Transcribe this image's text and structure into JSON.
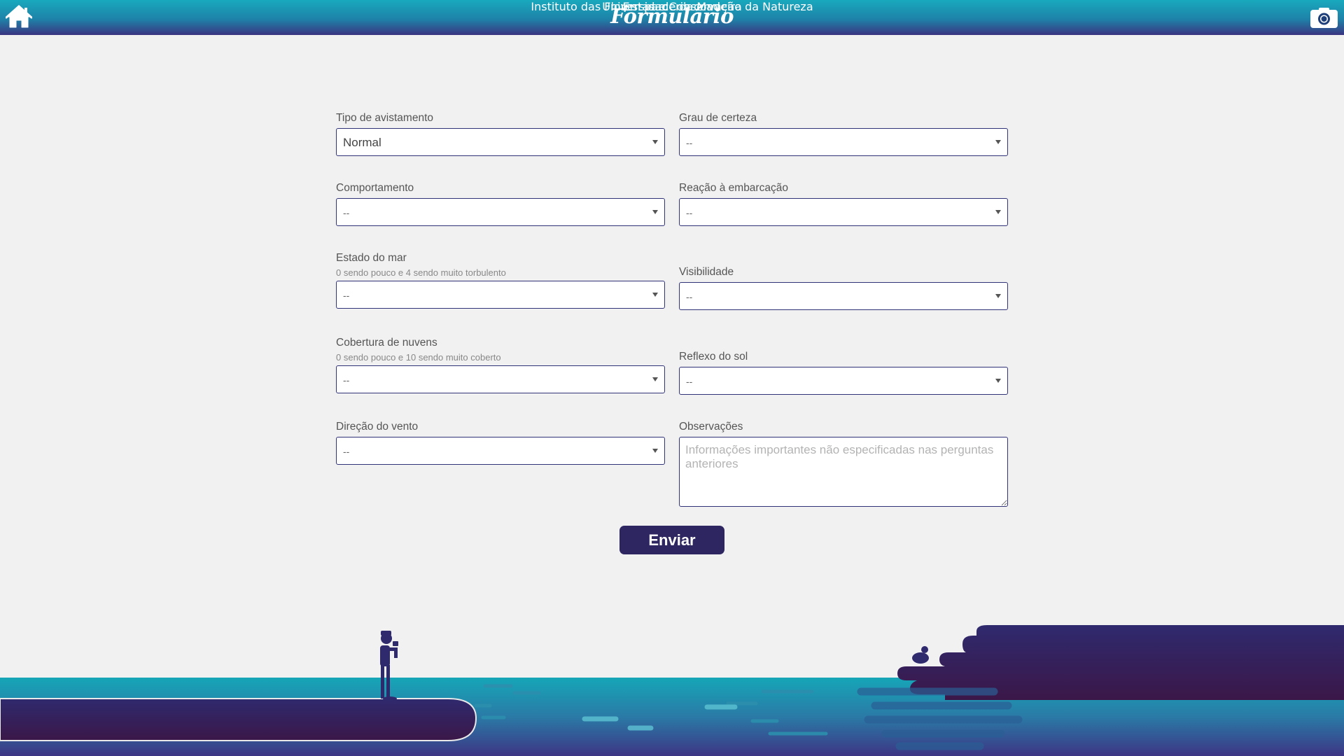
{
  "header": {
    "title": "Formulário",
    "home_icon": "home-icon",
    "camera_icon": "camera-icon",
    "colors": {
      "top": "#18a9bd",
      "bottom": "#3a3480"
    }
  },
  "form": {
    "tipo_avistamento": {
      "label": "Tipo de avistamento",
      "value": "Normal"
    },
    "grau_certeza": {
      "label": "Grau de certeza",
      "value": "--"
    },
    "comportamento": {
      "label": "Comportamento",
      "value": "--"
    },
    "reacao_embarcacao": {
      "label": "Reação à embarcação",
      "value": "--"
    },
    "estado_mar": {
      "label": "Estado do mar",
      "hint": "0 sendo pouco e 4 sendo muito torbulento",
      "value": "--"
    },
    "visibilidade": {
      "label": "Visibilidade",
      "value": "--"
    },
    "cobertura_nuvens": {
      "label": "Cobertura de nuvens",
      "hint": "0 sendo pouco e 10 sendo muito coberto",
      "value": "--"
    },
    "reflexo_sol": {
      "label": "Reflexo do sol",
      "value": "--"
    },
    "direcao_vento": {
      "label": "Direção do vento",
      "value": "--"
    },
    "observacoes": {
      "label": "Observações",
      "placeholder": "Informações importantes não especificadas nas perguntas anteriores"
    },
    "submit_label": "Enviar"
  },
  "footer": {
    "partners_title": "Em parceria com:",
    "partner_1": "Universidade da Madeira",
    "partner_2": "Instituto das Florestas e Conservação da Natureza",
    "colors": {
      "dark": "#2e2161",
      "sea": "#1aa4b5"
    }
  }
}
